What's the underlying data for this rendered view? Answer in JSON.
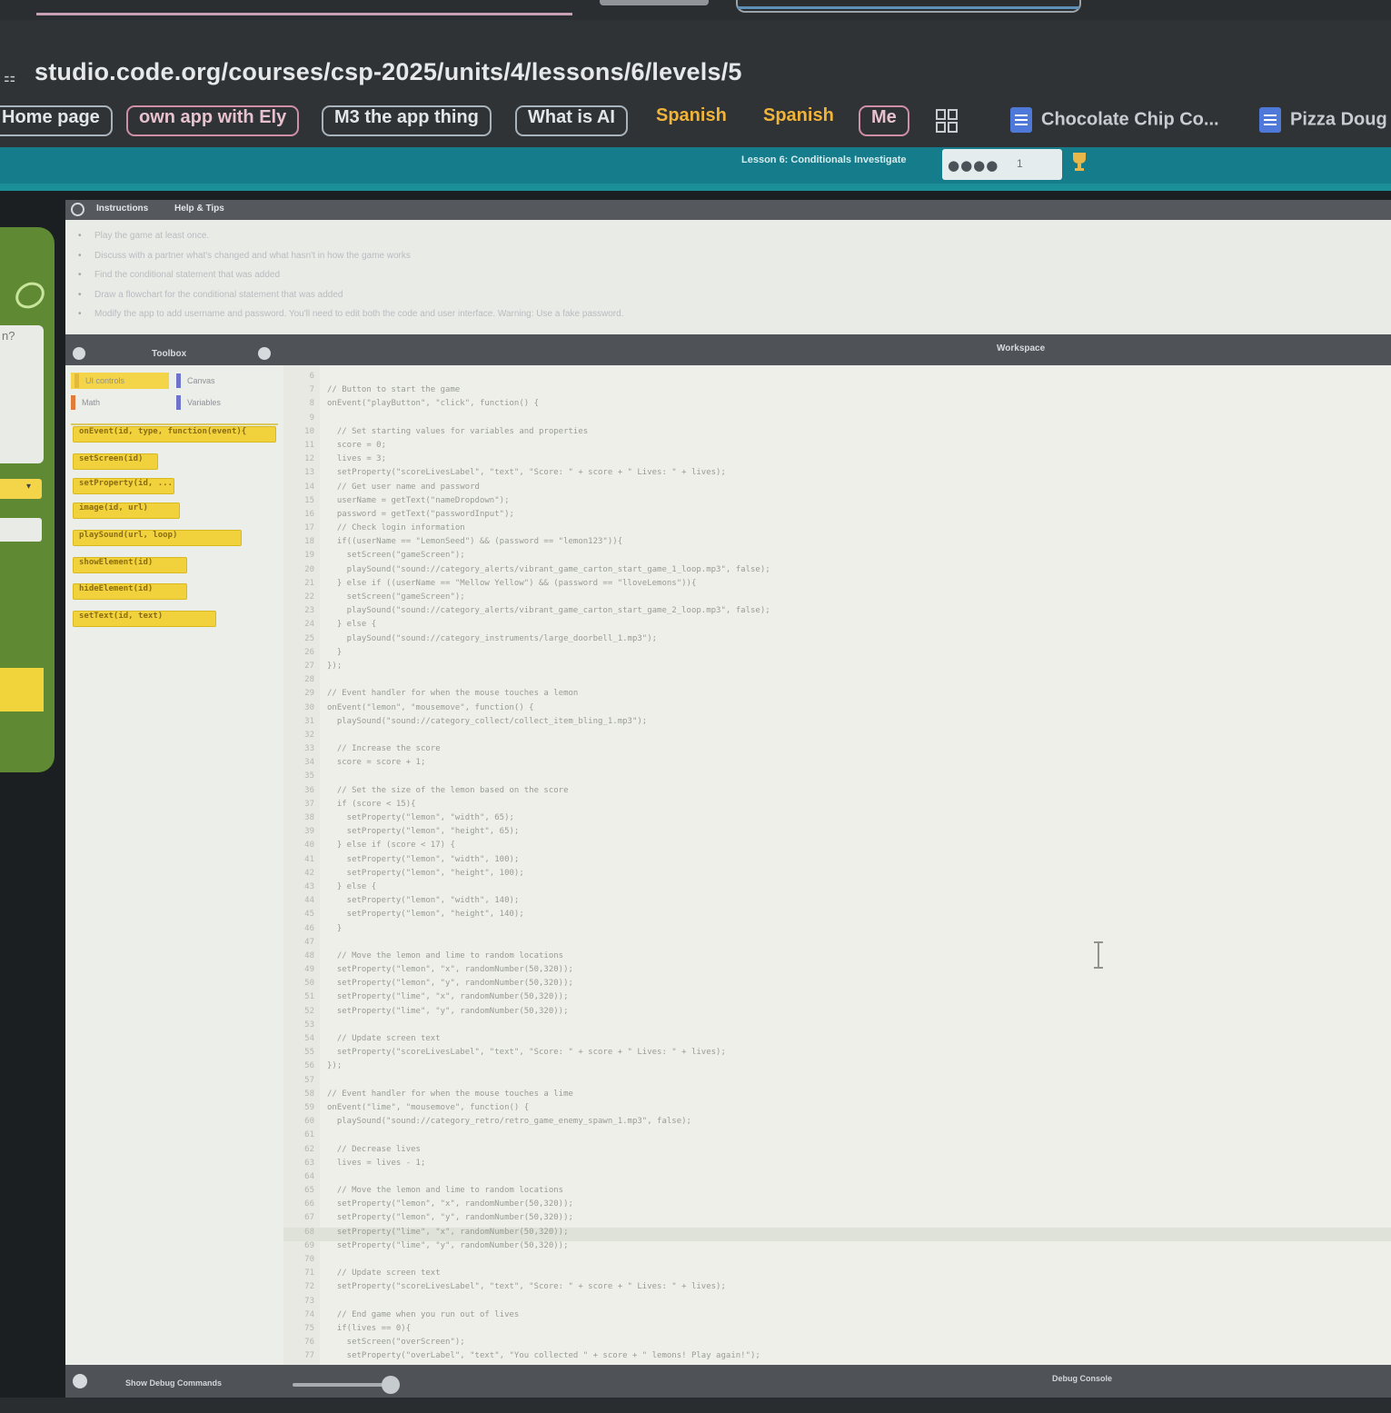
{
  "browser": {
    "url": "studio.code.org/courses/csp-2025/units/4/lessons/6/levels/5",
    "bookmarks": [
      {
        "label": "Home page",
        "style": "boxed"
      },
      {
        "label": "own app with Ely",
        "style": "boxed-pink"
      },
      {
        "label": "M3 the app thing",
        "style": "boxed"
      },
      {
        "label": "What is AI",
        "style": "boxed"
      },
      {
        "label": "Spanish",
        "style": "plain"
      },
      {
        "label": "Spanish",
        "style": "plain"
      },
      {
        "label": "Me",
        "style": "boxed-pink"
      }
    ],
    "docs": [
      {
        "label": "Chocolate Chip Co...",
        "icon": "doc-icon"
      },
      {
        "label": "Pizza Doug",
        "icon": "doc-icon"
      }
    ]
  },
  "header": {
    "lesson_title": "Lesson 6: Conditionals Investigate",
    "progress_dots": "●●●●",
    "progress_num": "1",
    "accent": "#147c8a"
  },
  "instructions": {
    "tabs": [
      "Instructions",
      "Help & Tips"
    ],
    "items": [
      "Play the game at least once.",
      "Discuss with a partner what's changed and what hasn't in how the game works",
      "Find the conditional statement that was added",
      "Draw a flowchart for the conditional statement that was added",
      "Modify the app to add username and password. You'll need to edit both the code and user interface. Warning: Use a fake password."
    ]
  },
  "workspace": {
    "toolbox_title": "Toolbox",
    "title": "Workspace",
    "categories": [
      {
        "label": "UI controls",
        "color": "#f4d54a"
      },
      {
        "label": "Canvas",
        "color": "#6e74c9"
      },
      {
        "label": "Math",
        "color": "#e07b3a"
      },
      {
        "label": "Variables",
        "color": "#6e74c9"
      }
    ],
    "blocks": [
      "onEvent(id, type, function(event){",
      "setScreen(id)",
      "setProperty(id, ...)",
      "image(id, url)",
      "playSound(url, loop)",
      "showElement(id)",
      "hideElement(id)",
      "setText(id, text)"
    ],
    "footer_left": "Show Debug Commands",
    "footer_right": "Debug Console"
  },
  "code": [
    {
      "n": "6",
      "t": ""
    },
    {
      "n": "7",
      "t": "// Button to start the game"
    },
    {
      "n": "8",
      "t": "onEvent(\"playButton\", \"click\", function() {"
    },
    {
      "n": "9",
      "t": ""
    },
    {
      "n": "10",
      "t": "  // Set starting values for variables and properties"
    },
    {
      "n": "11",
      "t": "  score = 0;"
    },
    {
      "n": "12",
      "t": "  lives = 3;"
    },
    {
      "n": "13",
      "t": "  setProperty(\"scoreLivesLabel\", \"text\", \"Score: \" + score + \" Lives: \" + lives);"
    },
    {
      "n": "14",
      "t": "  // Get user name and password"
    },
    {
      "n": "15",
      "t": "  userName = getText(\"nameDropdown\");"
    },
    {
      "n": "16",
      "t": "  password = getText(\"passwordInput\");"
    },
    {
      "n": "17",
      "t": "  // Check login information"
    },
    {
      "n": "18",
      "t": "  if((userName == \"LemonSeed\") && (password == \"lemon123\")){"
    },
    {
      "n": "19",
      "t": "    setScreen(\"gameScreen\");"
    },
    {
      "n": "20",
      "t": "    playSound(\"sound://category_alerts/vibrant_game_carton_start_game_1_loop.mp3\", false);"
    },
    {
      "n": "21",
      "t": "  } else if ((userName == \"Mellow Yellow\") && (password == \"lloveLemons\")){"
    },
    {
      "n": "22",
      "t": "    setScreen(\"gameScreen\");"
    },
    {
      "n": "23",
      "t": "    playSound(\"sound://category_alerts/vibrant_game_carton_start_game_2_loop.mp3\", false);"
    },
    {
      "n": "24",
      "t": "  } else {"
    },
    {
      "n": "25",
      "t": "    playSound(\"sound://category_instruments/large_doorbell_1.mp3\");"
    },
    {
      "n": "26",
      "t": "  }"
    },
    {
      "n": "27",
      "t": "});"
    },
    {
      "n": "28",
      "t": ""
    },
    {
      "n": "29",
      "t": "// Event handler for when the mouse touches a lemon"
    },
    {
      "n": "30",
      "t": "onEvent(\"lemon\", \"mousemove\", function() {"
    },
    {
      "n": "31",
      "t": "  playSound(\"sound://category_collect/collect_item_bling_1.mp3\");"
    },
    {
      "n": "32",
      "t": ""
    },
    {
      "n": "33",
      "t": "  // Increase the score"
    },
    {
      "n": "34",
      "t": "  score = score + 1;"
    },
    {
      "n": "35",
      "t": ""
    },
    {
      "n": "36",
      "t": "  // Set the size of the lemon based on the score"
    },
    {
      "n": "37",
      "t": "  if (score < 15){"
    },
    {
      "n": "38",
      "t": "    setProperty(\"lemon\", \"width\", 65);"
    },
    {
      "n": "39",
      "t": "    setProperty(\"lemon\", \"height\", 65);"
    },
    {
      "n": "40",
      "t": "  } else if (score < 17) {"
    },
    {
      "n": "41",
      "t": "    setProperty(\"lemon\", \"width\", 100);"
    },
    {
      "n": "42",
      "t": "    setProperty(\"lemon\", \"height\", 100);"
    },
    {
      "n": "43",
      "t": "  } else {"
    },
    {
      "n": "44",
      "t": "    setProperty(\"lemon\", \"width\", 140);"
    },
    {
      "n": "45",
      "t": "    setProperty(\"lemon\", \"height\", 140);"
    },
    {
      "n": "46",
      "t": "  }"
    },
    {
      "n": "47",
      "t": ""
    },
    {
      "n": "48",
      "t": "  // Move the lemon and lime to random locations"
    },
    {
      "n": "49",
      "t": "  setProperty(\"lemon\", \"x\", randomNumber(50,320));"
    },
    {
      "n": "50",
      "t": "  setProperty(\"lemon\", \"y\", randomNumber(50,320));"
    },
    {
      "n": "51",
      "t": "  setProperty(\"lime\", \"x\", randomNumber(50,320));"
    },
    {
      "n": "52",
      "t": "  setProperty(\"lime\", \"y\", randomNumber(50,320));"
    },
    {
      "n": "53",
      "t": ""
    },
    {
      "n": "54",
      "t": "  // Update screen text"
    },
    {
      "n": "55",
      "t": "  setProperty(\"scoreLivesLabel\", \"text\", \"Score: \" + score + \" Lives: \" + lives);"
    },
    {
      "n": "56",
      "t": "});"
    },
    {
      "n": "57",
      "t": ""
    },
    {
      "n": "58",
      "t": "// Event handler for when the mouse touches a lime"
    },
    {
      "n": "59",
      "t": "onEvent(\"lime\", \"mousemove\", function() {"
    },
    {
      "n": "60",
      "t": "  playSound(\"sound://category_retro/retro_game_enemy_spawn_1.mp3\", false);"
    },
    {
      "n": "61",
      "t": ""
    },
    {
      "n": "62",
      "t": "  // Decrease lives"
    },
    {
      "n": "63",
      "t": "  lives = lives - 1;"
    },
    {
      "n": "64",
      "t": ""
    },
    {
      "n": "65",
      "t": "  // Move the lemon and lime to random locations"
    },
    {
      "n": "66",
      "t": "  setProperty(\"lemon\", \"x\", randomNumber(50,320));"
    },
    {
      "n": "67",
      "t": "  setProperty(\"lemon\", \"y\", randomNumber(50,320));"
    },
    {
      "n": "68",
      "t": "  setProperty(\"lime\", \"x\", randomNumber(50,320));"
    },
    {
      "n": "69",
      "t": "  setProperty(\"lime\", \"y\", randomNumber(50,320));"
    },
    {
      "n": "70",
      "t": ""
    },
    {
      "n": "71",
      "t": "  // Update screen text"
    },
    {
      "n": "72",
      "t": "  setProperty(\"scoreLivesLabel\", \"text\", \"Score: \" + score + \" Lives: \" + lives);"
    },
    {
      "n": "73",
      "t": ""
    },
    {
      "n": "74",
      "t": "  // End game when you run out of lives"
    },
    {
      "n": "75",
      "t": "  if(lives == 0){"
    },
    {
      "n": "76",
      "t": "    setScreen(\"overScreen\");"
    },
    {
      "n": "77",
      "t": "    setProperty(\"overLabel\", \"text\", \"You collected \" + score + \" lemons! Play again!\");"
    }
  ]
}
